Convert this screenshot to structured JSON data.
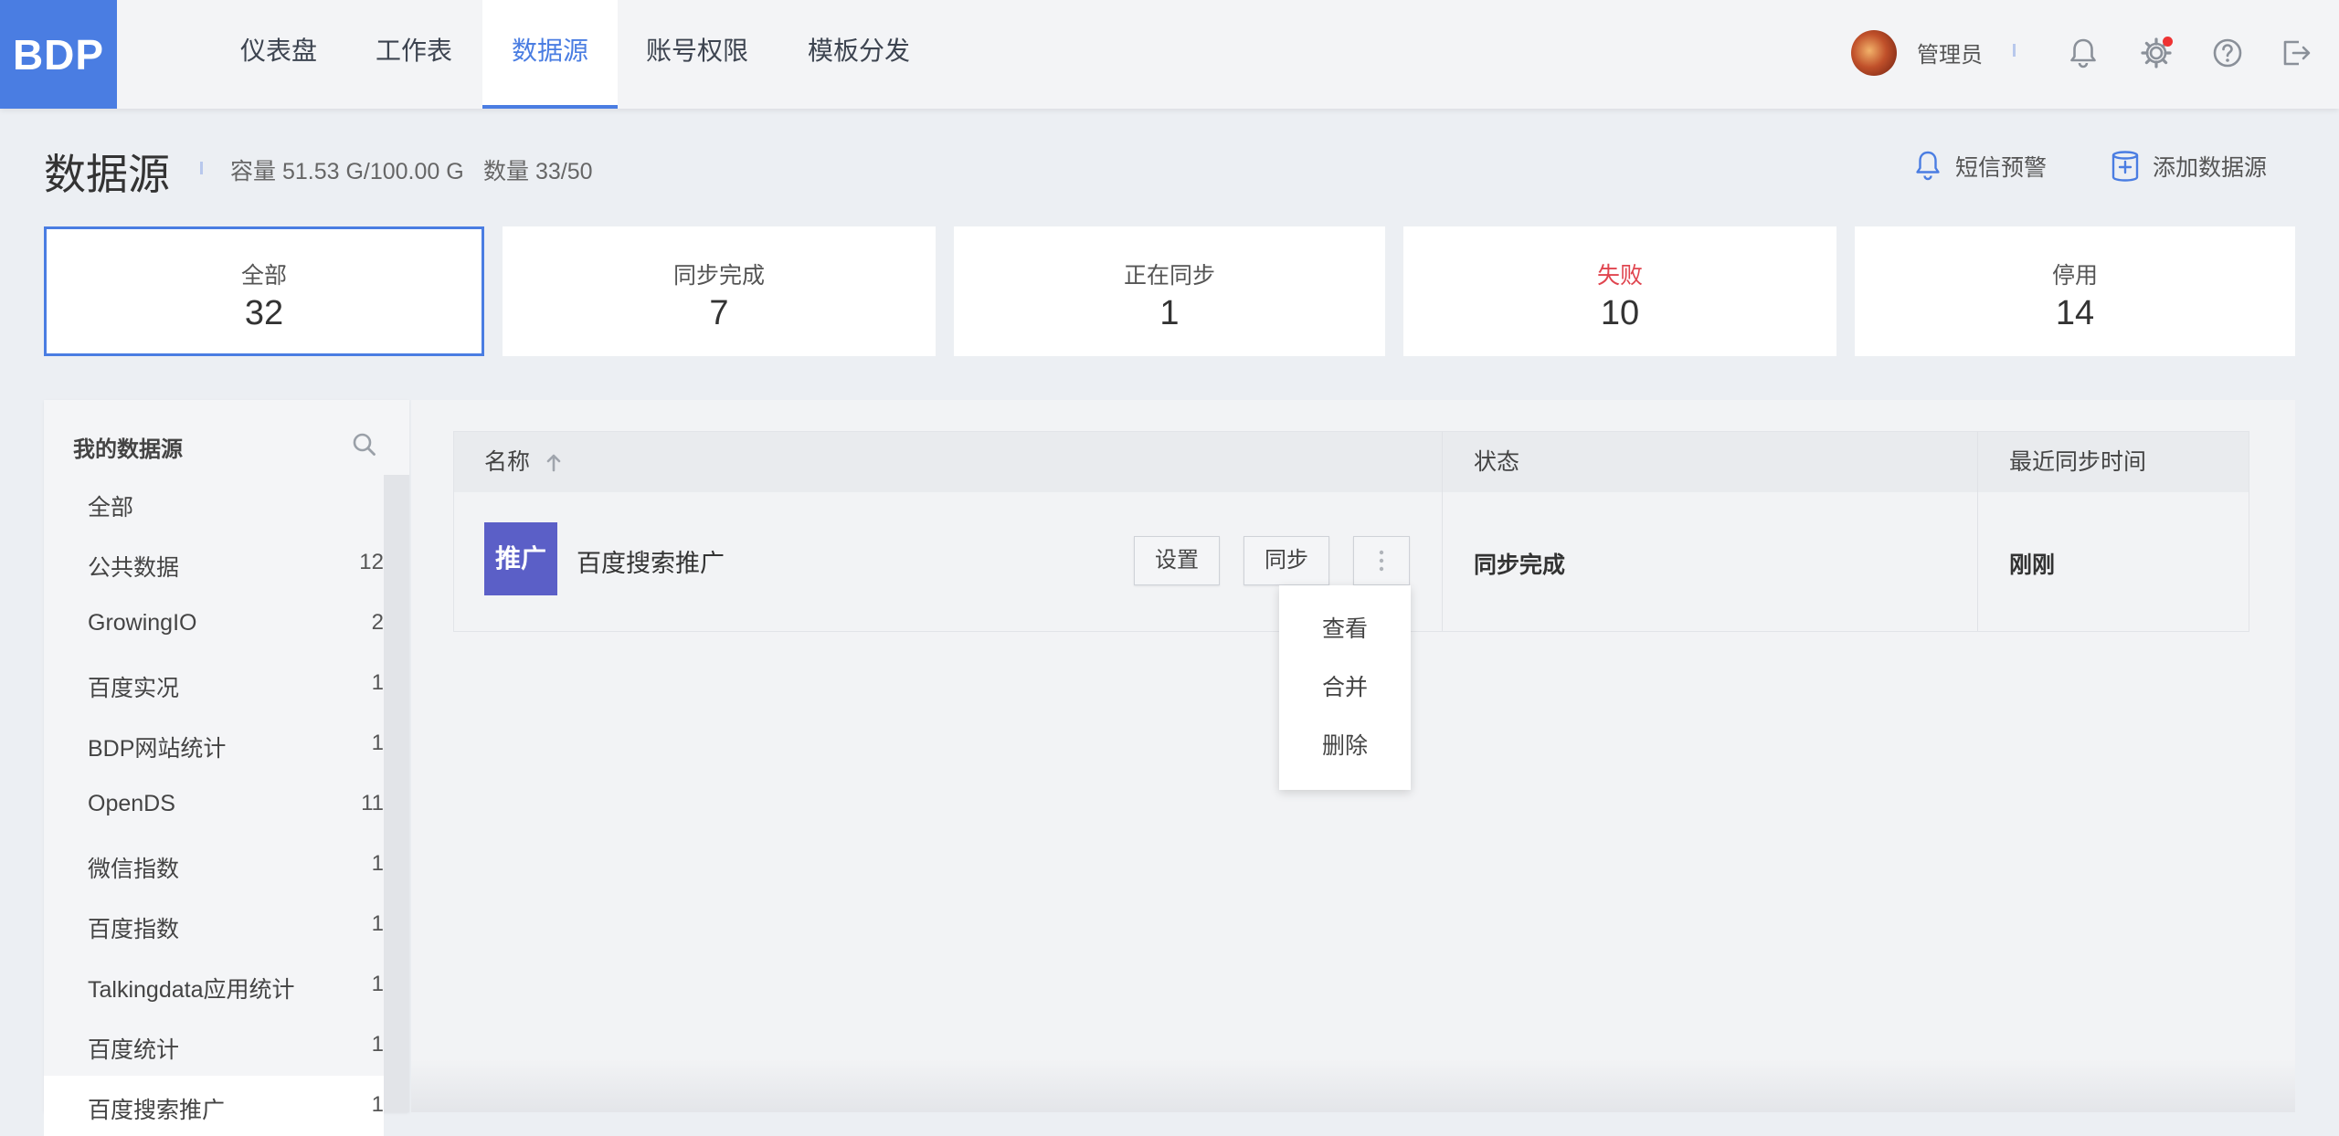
{
  "app": {
    "logo": "BDP"
  },
  "nav": {
    "items": [
      {
        "label": "仪表盘",
        "active": false
      },
      {
        "label": "工作表",
        "active": false
      },
      {
        "label": "数据源",
        "active": true
      },
      {
        "label": "账号权限",
        "active": false
      },
      {
        "label": "模板分发",
        "active": false
      }
    ],
    "user_name": "管理员",
    "accent_color": "#4a7de2",
    "icons": [
      "bell-icon",
      "settings-icon",
      "help-icon",
      "logout-icon"
    ]
  },
  "header": {
    "title": "数据源",
    "capacity": "容量 51.53 G/100.00 G",
    "count": "数量 33/50",
    "sms_alert": "短信预警",
    "add_datasource": "添加数据源"
  },
  "stats": [
    {
      "label": "全部",
      "value": "32",
      "active": true
    },
    {
      "label": "同步完成",
      "value": "7"
    },
    {
      "label": "正在同步",
      "value": "1"
    },
    {
      "label": "失败",
      "value": "10",
      "color": "#e0454f"
    },
    {
      "label": "停用",
      "value": "14"
    }
  ],
  "sidebar": {
    "title": "我的数据源",
    "items": [
      {
        "label": "全部",
        "count": ""
      },
      {
        "label": "公共数据",
        "count": "12"
      },
      {
        "label": "GrowingIO",
        "count": "2"
      },
      {
        "label": "百度实况",
        "count": "1"
      },
      {
        "label": "BDP网站统计",
        "count": "1"
      },
      {
        "label": "OpenDS",
        "count": "11"
      },
      {
        "label": "微信指数",
        "count": "1"
      },
      {
        "label": "百度指数",
        "count": "1"
      },
      {
        "label": "Talkingdata应用统计",
        "count": "1"
      },
      {
        "label": "百度统计",
        "count": "1"
      },
      {
        "label": "百度搜索推广",
        "count": "1",
        "selected": true
      }
    ]
  },
  "table": {
    "columns": [
      "名称",
      "状态",
      "最近同步时间"
    ],
    "rows": [
      {
        "logo_text": "推广",
        "name": "百度搜索推广",
        "settings_label": "设置",
        "sync_label": "同步",
        "status": "同步完成",
        "last_sync": "刚刚"
      }
    ]
  },
  "dropdown": {
    "items": [
      "查看",
      "合并",
      "删除"
    ]
  }
}
